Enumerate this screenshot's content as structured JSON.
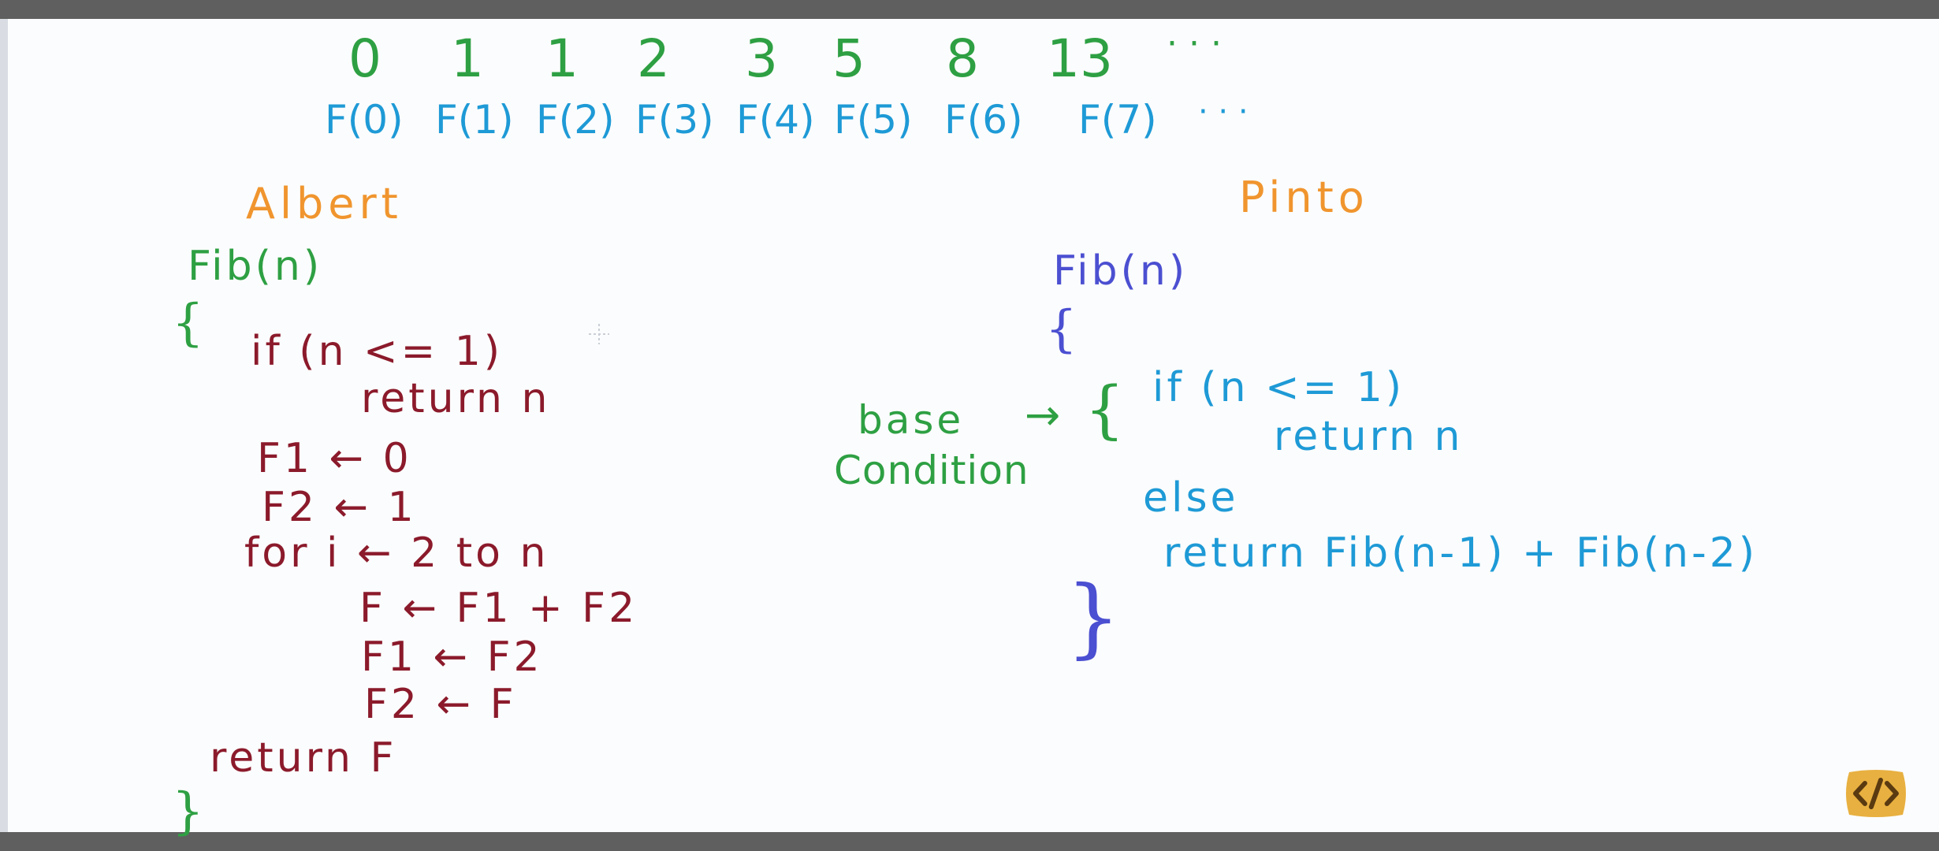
{
  "colors": {
    "green": "#2ea043",
    "blue": "#1e9ad6",
    "orange": "#f0952e",
    "darkred": "#8b1a2b",
    "purple": "#4b4fd1",
    "logo": "#e8b040"
  },
  "sequence": {
    "numbers": [
      "0",
      "1",
      "1",
      "2",
      "3",
      "5",
      "8",
      "13",
      "· · ·"
    ],
    "functions": [
      "F(0)",
      "F(1)",
      "F(2)",
      "F(3)",
      "F(4)",
      "F(5)",
      "F(6)",
      "F(7)",
      "· · ·"
    ]
  },
  "albert": {
    "name": "Albert",
    "signature": "Fib(n)",
    "open_brace": "{",
    "lines": [
      "if (n <= 1)",
      "return n",
      "F1 ← 0",
      "F2 ← 1",
      "for i ← 2 to n",
      "F ← F1 + F2",
      "F1 ← F2",
      "F2 ← F",
      "return F"
    ],
    "close_brace": "}"
  },
  "pinto": {
    "name": "Pinto",
    "signature": "Fib(n)",
    "open_brace": "{",
    "annotation_line1": "base",
    "annotation_line2": "Condition",
    "arrow": "→",
    "lines": [
      "if (n <= 1)",
      "return n",
      "else",
      "return Fib(n-1) + Fib(n-2)"
    ],
    "close_brace": "}"
  },
  "logo_icon": "code-brackets-icon"
}
